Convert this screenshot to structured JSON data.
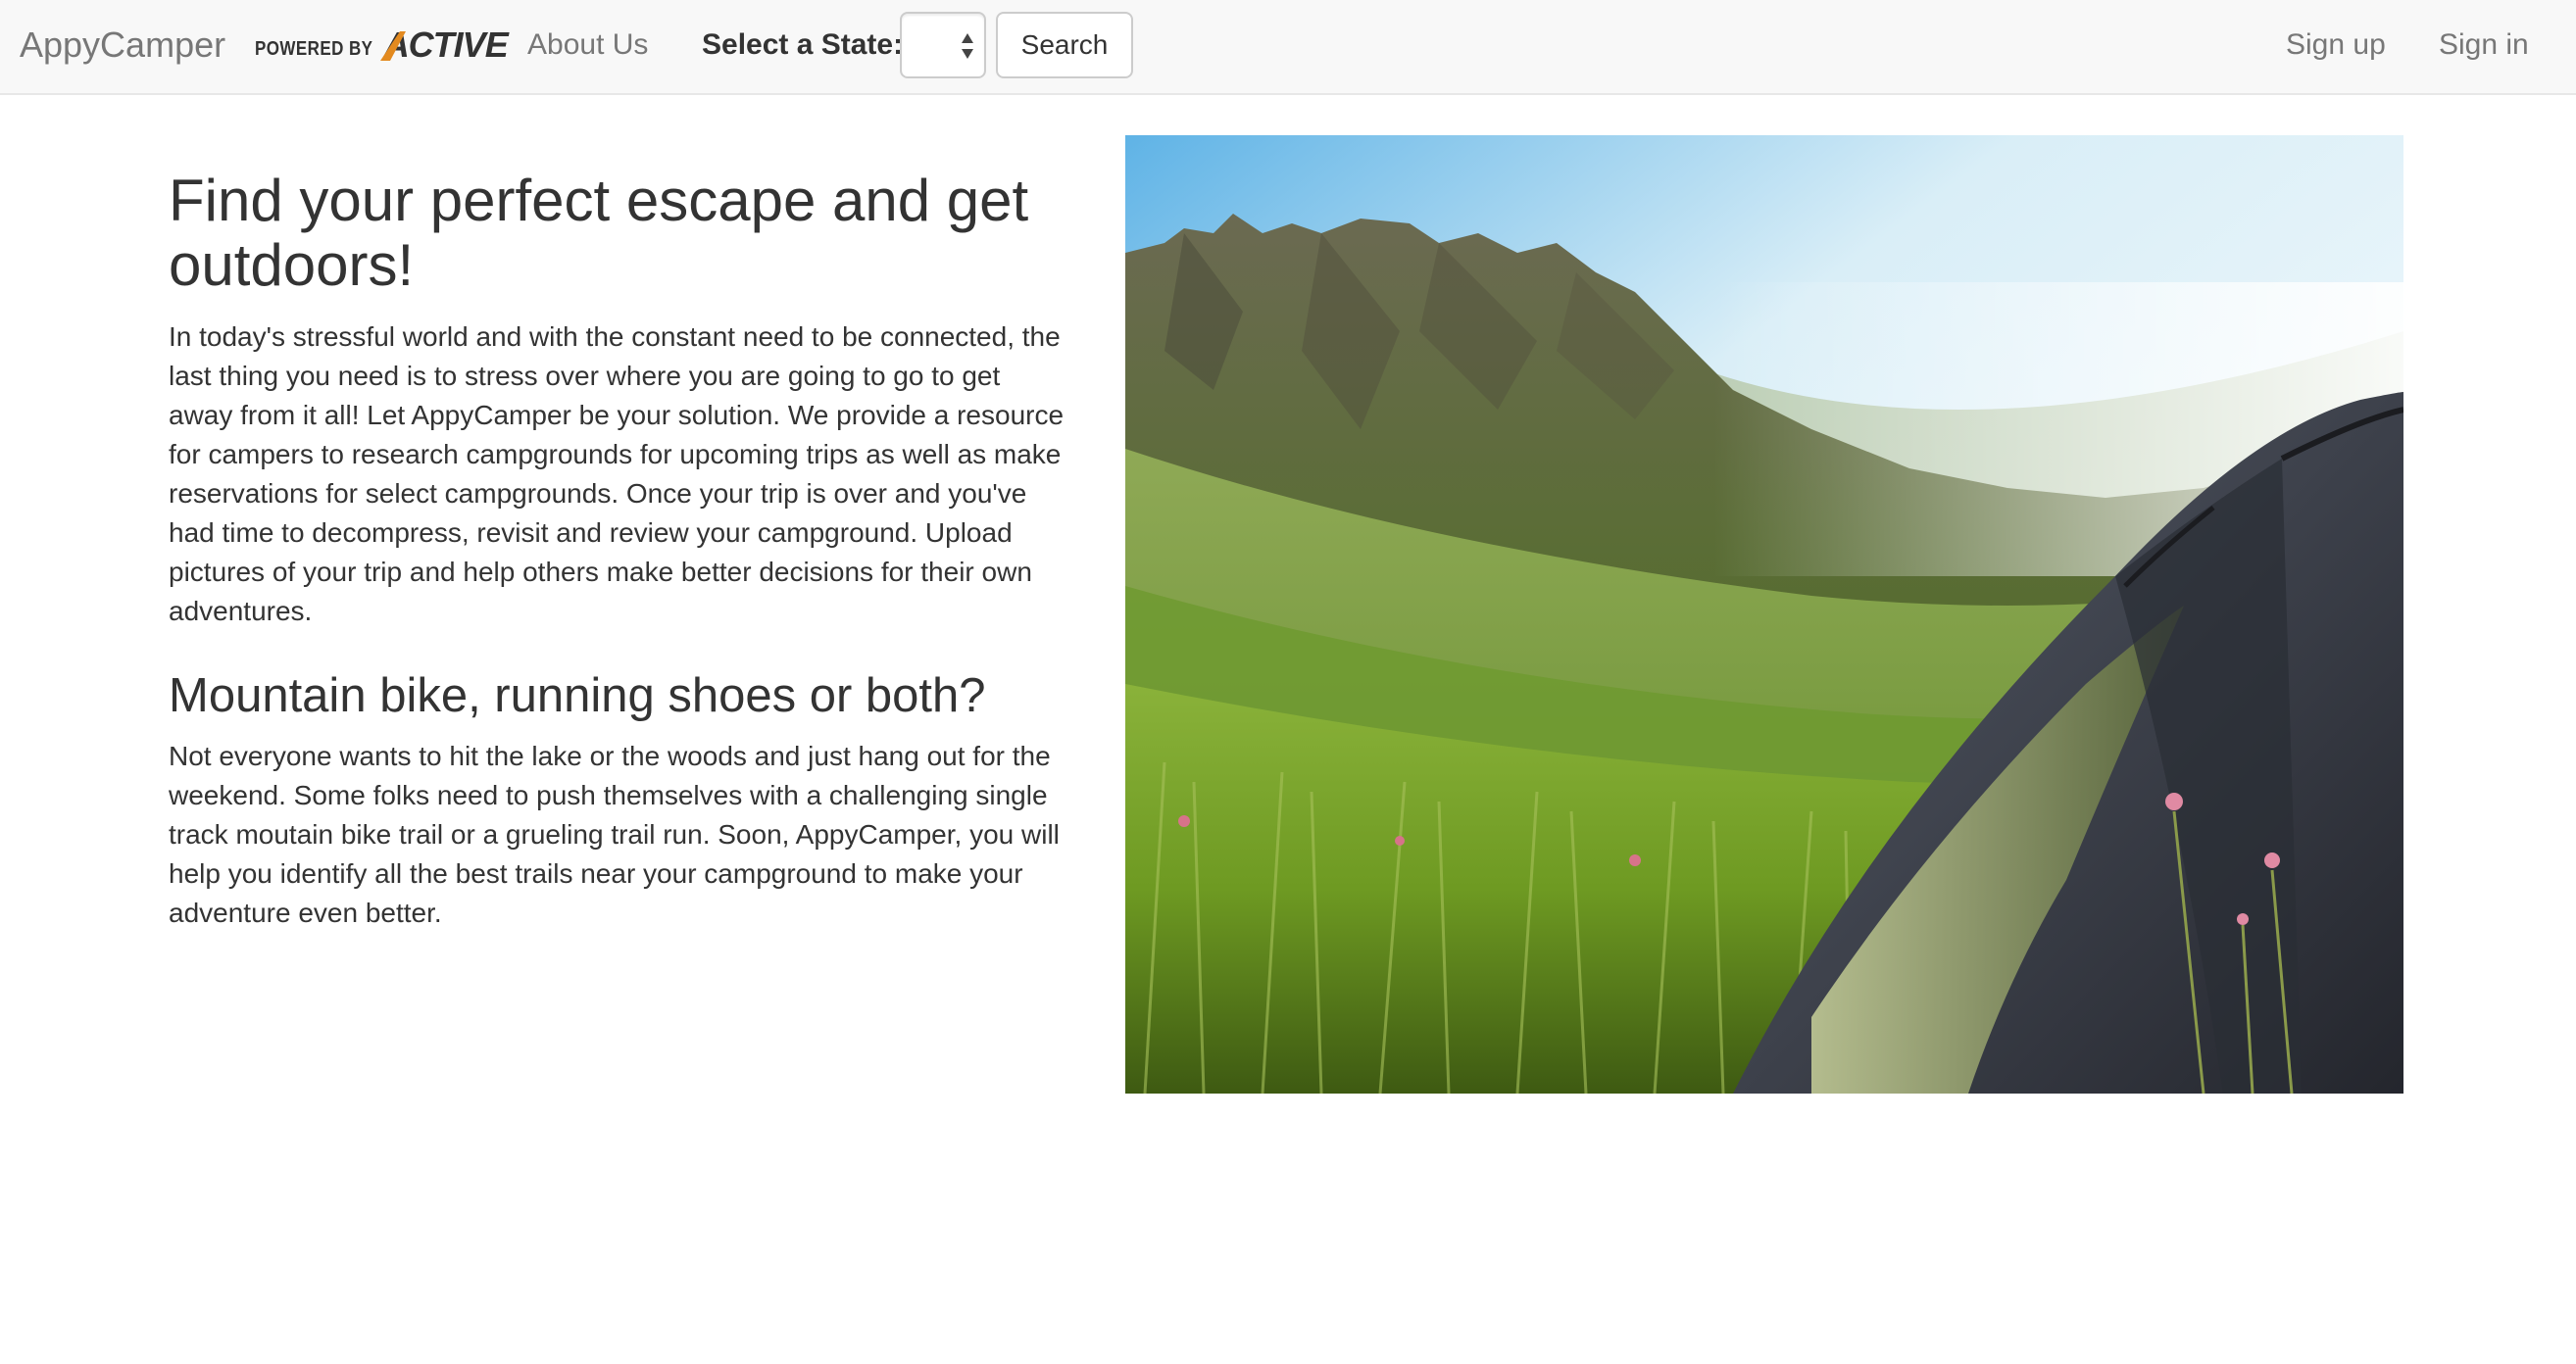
{
  "navbar": {
    "brand": "AppyCamper",
    "powered_by": "POWERED BY",
    "partner_logo": "ACTIVE",
    "about": "About Us",
    "state_label": "Select a State:",
    "state_value": "",
    "search_label": "Search",
    "signup": "Sign up",
    "signin": "Sign in"
  },
  "main": {
    "heading": "Find your perfect escape and get outdoors!",
    "intro": "In today's stressful world and with the constant need to be connected, the last thing you need is to stress over where you are going to go to get away from it all! Let AppyCamper be your solution. We provide a resource for campers to research campgrounds for upcoming trips as well as make reservations for select campgrounds. Once your trip is over and you've had time to decompress, revisit and review your campground. Upload pictures of your trip and help others make better decisions for their own adventures.",
    "subheading": "Mountain bike, running shoes or both?",
    "body": "Not everyone wants to hit the lake or the woods and just hang out for the weekend. Some folks need to push themselves with a challenging single track moutain bike trail or a grueling trail run. Soon, AppyCamper, you will help you identify all the best trails near your campground to make your adventure even better."
  },
  "hero": {
    "icon": "mountain-tent-photo",
    "colors": {
      "sky": "#bfe3f3",
      "mountain": "#5b6b3a",
      "meadow": "#6f9a2c",
      "tent": "#3f4553"
    }
  },
  "theme": {
    "navbar_bg": "#f8f8f8",
    "link_color": "#777777",
    "text_color": "#333333"
  }
}
